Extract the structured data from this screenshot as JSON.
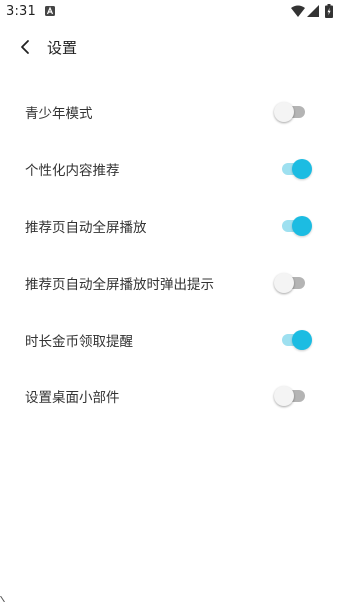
{
  "status_bar": {
    "time": "3:31",
    "icons": [
      "notification-icon",
      "wifi-icon",
      "signal-icon",
      "battery-charging-icon"
    ]
  },
  "header": {
    "back_icon": "chevron-left-icon",
    "title": "设置"
  },
  "settings": [
    {
      "label": "青少年模式",
      "enabled": false
    },
    {
      "label": "个性化内容推荐",
      "enabled": true
    },
    {
      "label": "推荐页自动全屏播放",
      "enabled": true
    },
    {
      "label": "推荐页自动全屏播放时弹出提示",
      "enabled": false
    },
    {
      "label": "时长金币领取提醒",
      "enabled": true
    },
    {
      "label": "设置桌面小部件",
      "enabled": false
    }
  ],
  "colors": {
    "switch_on_thumb": "#1cbce2",
    "switch_on_track": "#9ee0f0",
    "switch_off_thumb": "#f4f4f4",
    "switch_off_track": "#b4b4b4"
  }
}
